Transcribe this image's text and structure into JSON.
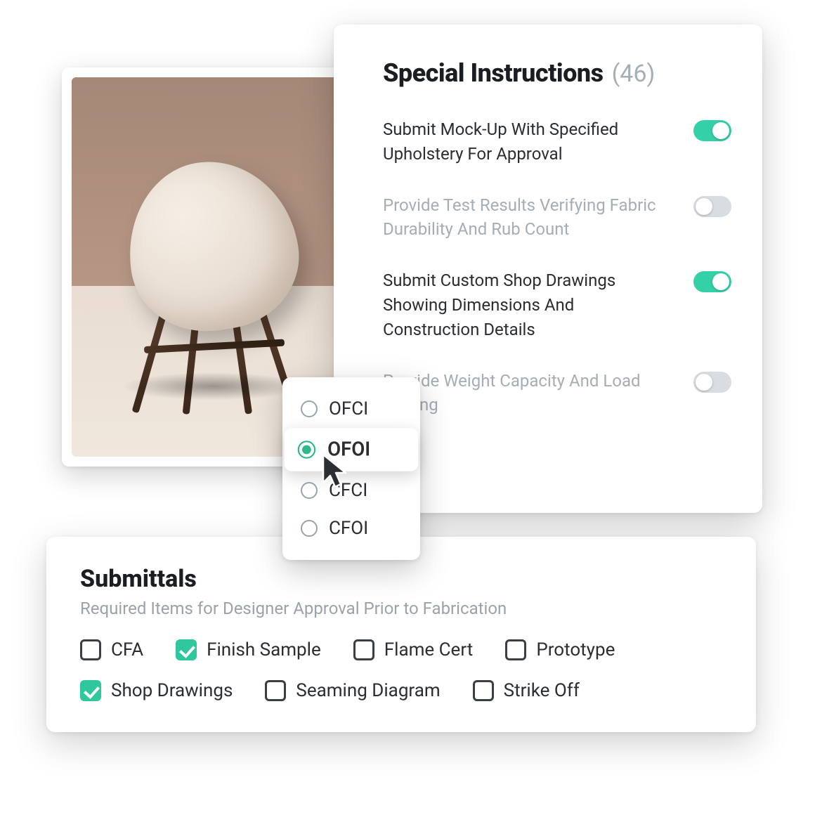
{
  "product": {
    "alt": "Upholstered armchair"
  },
  "instructions": {
    "title": "Special Instructions",
    "count": "(46)",
    "items": [
      {
        "text": "Submit Mock-Up With Specified Upholstery For Approval",
        "on": true
      },
      {
        "text": "Provide Test Results Verifying Fabric Durability And Rub Count",
        "on": false
      },
      {
        "text": "Submit Custom Shop Drawings Showing Dimensions And Construction Details",
        "on": true
      },
      {
        "text": "Provide Weight Capacity And Load Testing",
        "on": false
      }
    ]
  },
  "radio": {
    "options": [
      {
        "label": "OFCI",
        "selected": false
      },
      {
        "label": "OFOI",
        "selected": true
      },
      {
        "label": "CFCI",
        "selected": false
      },
      {
        "label": "CFOI",
        "selected": false
      }
    ]
  },
  "submittals": {
    "title": "Submittals",
    "subtitle": "Required Items for Designer Approval Prior to Fabrication",
    "items": [
      {
        "label": "CFA",
        "checked": false
      },
      {
        "label": "Finish Sample",
        "checked": true
      },
      {
        "label": "Flame Cert",
        "checked": false
      },
      {
        "label": "Prototype",
        "checked": false
      },
      {
        "label": "Shop Drawings",
        "checked": true
      },
      {
        "label": "Seaming Diagram",
        "checked": false
      },
      {
        "label": "Strike Off",
        "checked": false
      }
    ]
  }
}
